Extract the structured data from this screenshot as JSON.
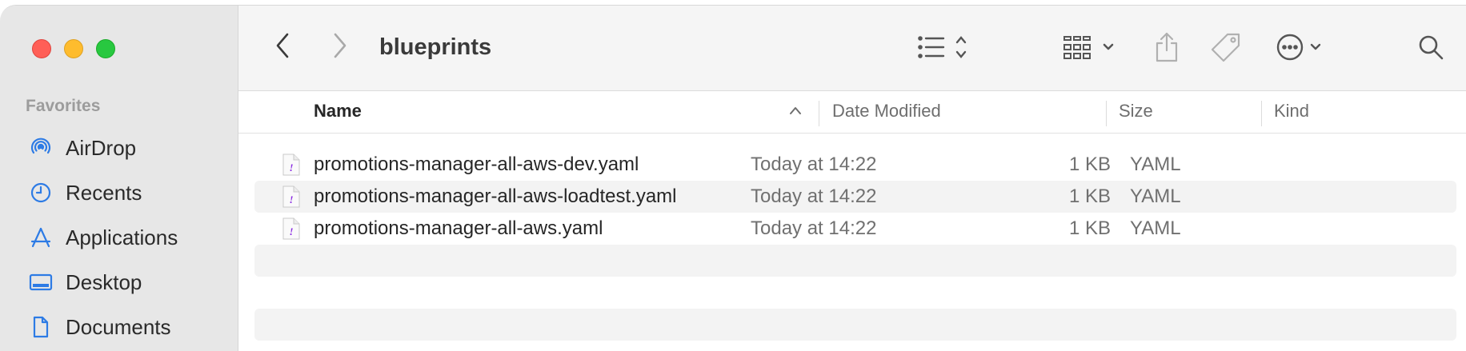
{
  "window": {
    "traffic_lights": [
      "close",
      "minimize",
      "zoom"
    ],
    "title": "blueprints"
  },
  "sidebar": {
    "heading": "Favorites",
    "items": [
      {
        "label": "AirDrop",
        "icon": "airdrop-icon"
      },
      {
        "label": "Recents",
        "icon": "clock-icon"
      },
      {
        "label": "Applications",
        "icon": "applications-icon"
      },
      {
        "label": "Desktop",
        "icon": "desktop-icon"
      },
      {
        "label": "Documents",
        "icon": "document-icon"
      }
    ]
  },
  "toolbar": {
    "back": "chevron-left-icon",
    "forward": "chevron-right-icon",
    "view": "list-view-icon",
    "group": "grid-group-icon",
    "share": "share-icon",
    "tag": "tag-icon",
    "more": "ellipsis-circle-icon",
    "search": "search-icon"
  },
  "columns": {
    "name": "Name",
    "date": "Date Modified",
    "size": "Size",
    "kind": "Kind"
  },
  "files": [
    {
      "name": "promotions-manager-all-aws-dev.yaml",
      "date": "Today at 14:22",
      "size": "1 KB",
      "kind": "YAML"
    },
    {
      "name": "promotions-manager-all-aws-loadtest.yaml",
      "date": "Today at 14:22",
      "size": "1 KB",
      "kind": "YAML"
    },
    {
      "name": "promotions-manager-all-aws.yaml",
      "date": "Today at 14:22",
      "size": "1 KB",
      "kind": "YAML"
    }
  ],
  "colors": {
    "accent": "#2d7be5",
    "sidebar_bg": "#e7e7e7",
    "row_alt": "#f3f3f3",
    "yaml_icon": "#8a2be2"
  }
}
